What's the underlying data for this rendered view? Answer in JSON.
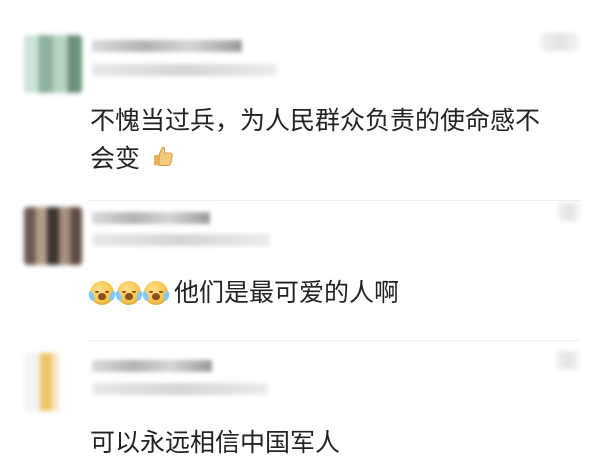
{
  "comments": [
    {
      "text_line_1": "不愧当过兵，为人民群众负责的使命感不",
      "text_line_2": "会变",
      "emoji": "thumbs-up-icon"
    },
    {
      "text": "他们是最可爱的人啊",
      "emoji_prefix": [
        "crying-face-icon",
        "crying-face-icon",
        "crying-face-icon"
      ]
    },
    {
      "text": "可以永远相信中国军人"
    }
  ],
  "colors": {
    "background": "#ffffff",
    "text": "#222222",
    "divider": "#efefef",
    "emoji_yellow": "#f6c64f",
    "emoji_tear": "#7fc9ff"
  }
}
